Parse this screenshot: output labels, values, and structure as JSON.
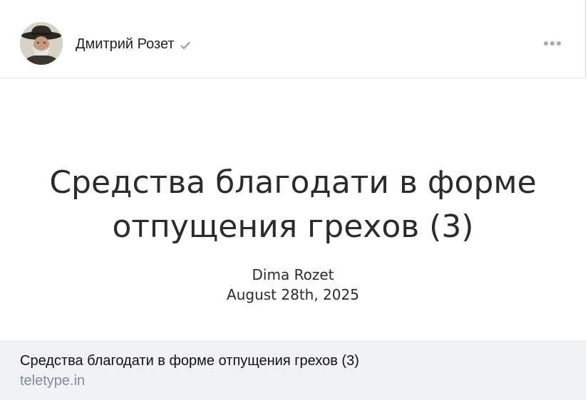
{
  "post": {
    "author_name": "Дмитрий Розет",
    "more_label": "…"
  },
  "preview": {
    "title": "Средства благодати в форме отпущения грехов (3)",
    "author": "Dima Rozet",
    "date": "August 28th, 2025"
  },
  "link": {
    "title": "Средства благодати в форме отпущения грехов (3)",
    "domain": "teletype.in"
  },
  "icons": {
    "verified": "verified-check-icon",
    "more": "more-dots-icon",
    "avatar": "avatar-photo"
  },
  "colors": {
    "footer_bg": "#f0f2f5",
    "domain_text": "#818c99",
    "icon_gray": "#a5aab2"
  }
}
